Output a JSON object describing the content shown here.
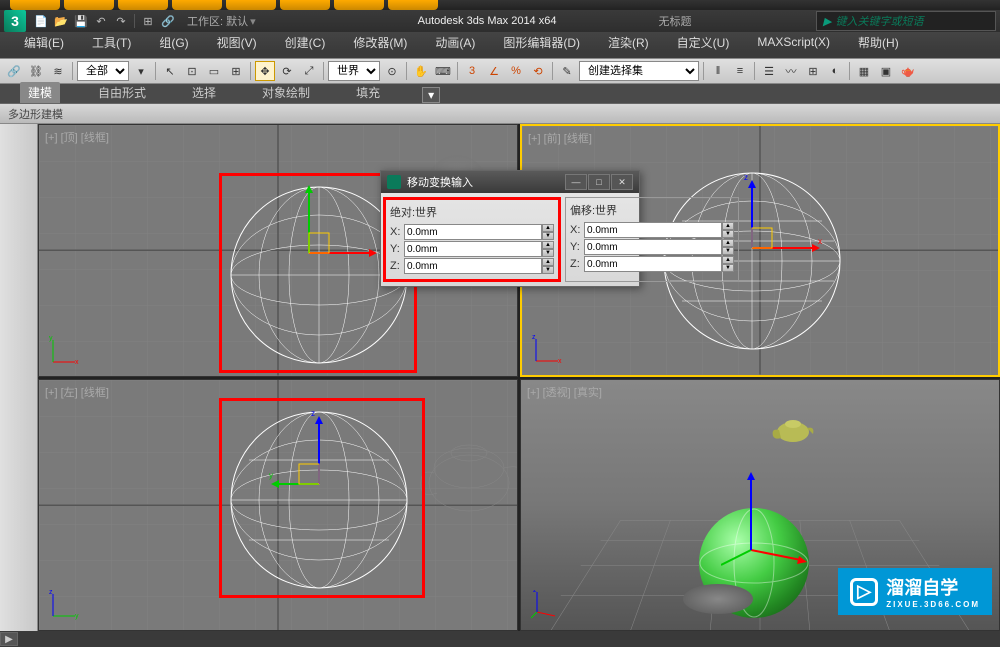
{
  "app": {
    "title": "Autodesk 3ds Max  2014 x64",
    "document": "无标题",
    "workspace_label": "工作区: 默认",
    "search_placeholder": "键入关键字或短语"
  },
  "menu": {
    "edit": "编辑(E)",
    "tools": "工具(T)",
    "group": "组(G)",
    "views": "视图(V)",
    "create": "创建(C)",
    "modifiers": "修改器(M)",
    "animation": "动画(A)",
    "graph_editors": "图形编辑器(D)",
    "rendering": "渲染(R)",
    "customize": "自定义(U)",
    "maxscript": "MAXScript(X)",
    "help": "帮助(H)"
  },
  "toolbar": {
    "filter_all": "全部",
    "coord_world": "世界",
    "selection_set": "创建选择集"
  },
  "ribbon": {
    "tabs": {
      "modeling": "建模",
      "freeform": "自由形式",
      "selection": "选择",
      "object_paint": "对象绘制",
      "populate": "填充"
    },
    "poly_modeling": "多边形建模"
  },
  "viewports": {
    "top": "[+] [顶] [线框]",
    "front": "[+] [前] [线框]",
    "left": "[+] [左] [线框]",
    "perspective": "[+] [透视] [真实]"
  },
  "dialog": {
    "title": "移动变换输入",
    "absolute_label": "绝对:世界",
    "offset_label": "偏移:世界",
    "x_label": "X:",
    "y_label": "Y:",
    "z_label": "Z:",
    "abs_x": "0.0mm",
    "abs_y": "0.0mm",
    "abs_z": "0.0mm",
    "off_x": "0.0mm",
    "off_y": "0.0mm",
    "off_z": "0.0mm"
  },
  "watermark": {
    "brand": "溜溜自学",
    "url": "ZIXUE.3D66.COM"
  }
}
